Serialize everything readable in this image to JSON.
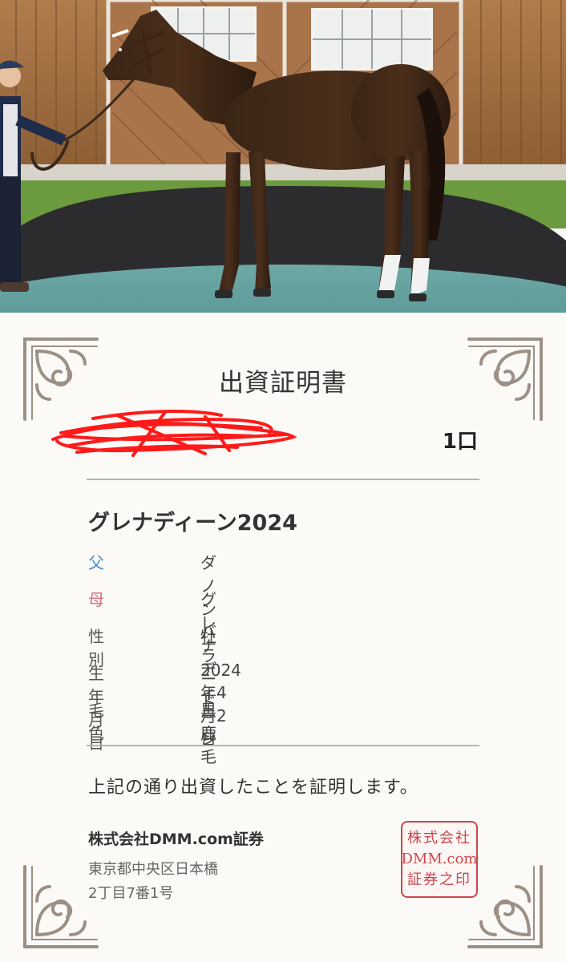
{
  "certificate": {
    "title": "出資証明書",
    "units": "1口",
    "horse_name": "グレナディーン2024",
    "fields": [
      {
        "label": "父",
        "value": "ダノンバラード"
      },
      {
        "label": "母",
        "value": "グレナディーン"
      },
      {
        "label": "性別",
        "value": "牡"
      },
      {
        "label": "生年月日",
        "value": "2024年4月2日"
      },
      {
        "label": "毛色",
        "value": "黒鹿毛"
      }
    ],
    "statement": "上記の通り出資したことを証明します。",
    "company": "株式会社DMM.com証券",
    "address_line1": "東京都中央区日本橋",
    "address_line2": "2丁目7番1号"
  },
  "seal": {
    "line1": "株式会社",
    "line2": "DMM.com",
    "line3": "証券之印"
  },
  "colors": {
    "sire_label": "#4a8fd3",
    "dam_label": "#d36c7a",
    "seal": "#c9474c",
    "redaction": "#ff1a1a",
    "background": "#fbfaf6"
  },
  "icons": {
    "corner": "ornamental-corner-flourish",
    "redaction": "red-scribble-redaction",
    "seal": "company-seal-stamp"
  }
}
